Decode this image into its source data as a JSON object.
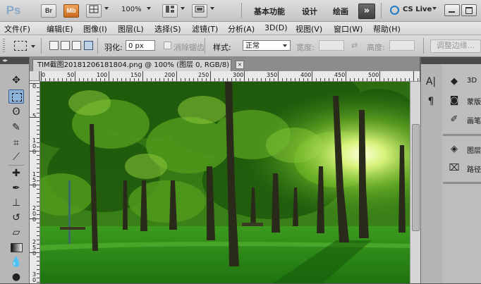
{
  "appbar": {
    "logo": "Ps",
    "bridge": "Br",
    "minibridge": "Mb",
    "zoom": "100%",
    "workspaces": [
      "基本功能",
      "设计",
      "绘画"
    ],
    "more": "»",
    "cslive": "CS Live"
  },
  "menu": [
    "文件(F)",
    "编辑(E)",
    "图像(I)",
    "图层(L)",
    "选择(S)",
    "滤镜(T)",
    "分析(A)",
    "3D(D)",
    "视图(V)",
    "窗口(W)",
    "帮助(H)"
  ],
  "options": {
    "feather_label": "羽化:",
    "feather_value": "0 px",
    "antialias_label": "消除锯齿",
    "style_label": "样式:",
    "style_value": "正常",
    "width_label": "宽度:",
    "height_label": "高度:",
    "refine_button": "调整边缘..."
  },
  "document": {
    "tab_title": "TIM截图20181206181804.png @ 100% (图层 0, RGB/8)",
    "close": "×",
    "ruler_top": [
      "0",
      "50",
      "100",
      "150",
      "200",
      "250",
      "300",
      "350",
      "400",
      "450",
      "500"
    ],
    "ruler_left": [
      "0",
      "5",
      "1\n0\n0",
      "1\n5\n0",
      "2\n0\n0",
      "2\n5\n0",
      "3\n0"
    ]
  },
  "panels": {
    "items": [
      "3D",
      "蒙版",
      "画笔",
      "图层",
      "路径"
    ]
  }
}
